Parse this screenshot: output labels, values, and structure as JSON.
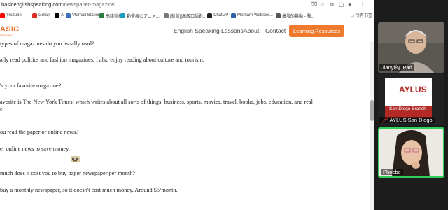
{
  "browser": {
    "url_domain": "basicenglishspeaking.com",
    "url_path": "/newspaper-magazine/",
    "toolbar_icons": [
      "translate-icon",
      "star-icon",
      "extensions-icon",
      "bookmark-side-icon",
      "profile-icon",
      "menu-icon"
    ]
  },
  "bookmarks": {
    "items": [
      {
        "label": "Youtube",
        "color": "#ff0000"
      },
      {
        "label": "Gmail",
        "color": "#d93025"
      },
      {
        "label": "X",
        "color": "#000000"
      },
      {
        "label": "Vtamall Station",
        "color": "#3b6fb6"
      },
      {
        "label": "高雄指標",
        "color": "#2a7d3c"
      },
      {
        "label": "動畫瘋のアニメ...",
        "color": "#1aa0c0"
      },
      {
        "label": "[新版][高級口語對...",
        "color": "#777777"
      },
      {
        "label": "ChatGPT",
        "color": "#222222"
      },
      {
        "label": "Merriam-Webster...",
        "color": "#2d5fa8"
      },
      {
        "label": "爆發的暴動 - 雅...",
        "color": "#555555"
      }
    ],
    "all_label": "所有书签"
  },
  "site": {
    "logo": "ASIC",
    "logo_sub": "SPEAKING",
    "nav": [
      "English Speaking Lessons",
      "About",
      "Contact"
    ],
    "cta": "Learning Resources"
  },
  "article": {
    "lines": [
      " types of magazines do you usually read?",
      "ally read politics and fashion magazines. I also enjoy reading about culture and tourism.",
      "'s your favorite magazine?",
      "avorite is The New York Times, which writes about all sorts of things: business, sports, movies, travel, books, jobs, education, and real",
      "e.",
      "ou read the paper or online news?",
      "er online news to save money.",
      "much does it cost you to buy paper newspaper per month?",
      " buy a monthly newspaper, so it doesn't cost much money. Around $5/month."
    ]
  },
  "video": {
    "participants": [
      {
        "name": "Jianyi的 iPad"
      },
      {
        "name": "AYLUS San Diego",
        "banner_title": "AYLUS",
        "banner_sub": "San Diego Branch"
      },
      {
        "name": "Phoebe"
      }
    ]
  }
}
